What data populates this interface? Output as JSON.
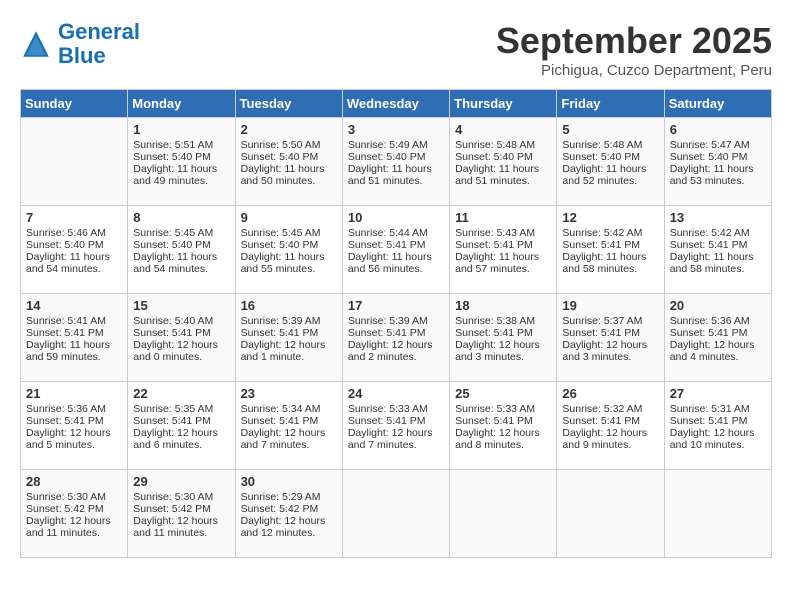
{
  "header": {
    "logo_general": "General",
    "logo_blue": "Blue",
    "month": "September 2025",
    "location": "Pichigua, Cuzco Department, Peru"
  },
  "days_of_week": [
    "Sunday",
    "Monday",
    "Tuesday",
    "Wednesday",
    "Thursday",
    "Friday",
    "Saturday"
  ],
  "weeks": [
    [
      {
        "day": "",
        "sunrise": "",
        "sunset": "",
        "daylight": ""
      },
      {
        "day": "1",
        "sunrise": "Sunrise: 5:51 AM",
        "sunset": "Sunset: 5:40 PM",
        "daylight": "Daylight: 11 hours and 49 minutes."
      },
      {
        "day": "2",
        "sunrise": "Sunrise: 5:50 AM",
        "sunset": "Sunset: 5:40 PM",
        "daylight": "Daylight: 11 hours and 50 minutes."
      },
      {
        "day": "3",
        "sunrise": "Sunrise: 5:49 AM",
        "sunset": "Sunset: 5:40 PM",
        "daylight": "Daylight: 11 hours and 51 minutes."
      },
      {
        "day": "4",
        "sunrise": "Sunrise: 5:48 AM",
        "sunset": "Sunset: 5:40 PM",
        "daylight": "Daylight: 11 hours and 51 minutes."
      },
      {
        "day": "5",
        "sunrise": "Sunrise: 5:48 AM",
        "sunset": "Sunset: 5:40 PM",
        "daylight": "Daylight: 11 hours and 52 minutes."
      },
      {
        "day": "6",
        "sunrise": "Sunrise: 5:47 AM",
        "sunset": "Sunset: 5:40 PM",
        "daylight": "Daylight: 11 hours and 53 minutes."
      }
    ],
    [
      {
        "day": "7",
        "sunrise": "Sunrise: 5:46 AM",
        "sunset": "Sunset: 5:40 PM",
        "daylight": "Daylight: 11 hours and 54 minutes."
      },
      {
        "day": "8",
        "sunrise": "Sunrise: 5:45 AM",
        "sunset": "Sunset: 5:40 PM",
        "daylight": "Daylight: 11 hours and 54 minutes."
      },
      {
        "day": "9",
        "sunrise": "Sunrise: 5:45 AM",
        "sunset": "Sunset: 5:40 PM",
        "daylight": "Daylight: 11 hours and 55 minutes."
      },
      {
        "day": "10",
        "sunrise": "Sunrise: 5:44 AM",
        "sunset": "Sunset: 5:41 PM",
        "daylight": "Daylight: 11 hours and 56 minutes."
      },
      {
        "day": "11",
        "sunrise": "Sunrise: 5:43 AM",
        "sunset": "Sunset: 5:41 PM",
        "daylight": "Daylight: 11 hours and 57 minutes."
      },
      {
        "day": "12",
        "sunrise": "Sunrise: 5:42 AM",
        "sunset": "Sunset: 5:41 PM",
        "daylight": "Daylight: 11 hours and 58 minutes."
      },
      {
        "day": "13",
        "sunrise": "Sunrise: 5:42 AM",
        "sunset": "Sunset: 5:41 PM",
        "daylight": "Daylight: 11 hours and 58 minutes."
      }
    ],
    [
      {
        "day": "14",
        "sunrise": "Sunrise: 5:41 AM",
        "sunset": "Sunset: 5:41 PM",
        "daylight": "Daylight: 11 hours and 59 minutes."
      },
      {
        "day": "15",
        "sunrise": "Sunrise: 5:40 AM",
        "sunset": "Sunset: 5:41 PM",
        "daylight": "Daylight: 12 hours and 0 minutes."
      },
      {
        "day": "16",
        "sunrise": "Sunrise: 5:39 AM",
        "sunset": "Sunset: 5:41 PM",
        "daylight": "Daylight: 12 hours and 1 minute."
      },
      {
        "day": "17",
        "sunrise": "Sunrise: 5:39 AM",
        "sunset": "Sunset: 5:41 PM",
        "daylight": "Daylight: 12 hours and 2 minutes."
      },
      {
        "day": "18",
        "sunrise": "Sunrise: 5:38 AM",
        "sunset": "Sunset: 5:41 PM",
        "daylight": "Daylight: 12 hours and 3 minutes."
      },
      {
        "day": "19",
        "sunrise": "Sunrise: 5:37 AM",
        "sunset": "Sunset: 5:41 PM",
        "daylight": "Daylight: 12 hours and 3 minutes."
      },
      {
        "day": "20",
        "sunrise": "Sunrise: 5:36 AM",
        "sunset": "Sunset: 5:41 PM",
        "daylight": "Daylight: 12 hours and 4 minutes."
      }
    ],
    [
      {
        "day": "21",
        "sunrise": "Sunrise: 5:36 AM",
        "sunset": "Sunset: 5:41 PM",
        "daylight": "Daylight: 12 hours and 5 minutes."
      },
      {
        "day": "22",
        "sunrise": "Sunrise: 5:35 AM",
        "sunset": "Sunset: 5:41 PM",
        "daylight": "Daylight: 12 hours and 6 minutes."
      },
      {
        "day": "23",
        "sunrise": "Sunrise: 5:34 AM",
        "sunset": "Sunset: 5:41 PM",
        "daylight": "Daylight: 12 hours and 7 minutes."
      },
      {
        "day": "24",
        "sunrise": "Sunrise: 5:33 AM",
        "sunset": "Sunset: 5:41 PM",
        "daylight": "Daylight: 12 hours and 7 minutes."
      },
      {
        "day": "25",
        "sunrise": "Sunrise: 5:33 AM",
        "sunset": "Sunset: 5:41 PM",
        "daylight": "Daylight: 12 hours and 8 minutes."
      },
      {
        "day": "26",
        "sunrise": "Sunrise: 5:32 AM",
        "sunset": "Sunset: 5:41 PM",
        "daylight": "Daylight: 12 hours and 9 minutes."
      },
      {
        "day": "27",
        "sunrise": "Sunrise: 5:31 AM",
        "sunset": "Sunset: 5:41 PM",
        "daylight": "Daylight: 12 hours and 10 minutes."
      }
    ],
    [
      {
        "day": "28",
        "sunrise": "Sunrise: 5:30 AM",
        "sunset": "Sunset: 5:42 PM",
        "daylight": "Daylight: 12 hours and 11 minutes."
      },
      {
        "day": "29",
        "sunrise": "Sunrise: 5:30 AM",
        "sunset": "Sunset: 5:42 PM",
        "daylight": "Daylight: 12 hours and 11 minutes."
      },
      {
        "day": "30",
        "sunrise": "Sunrise: 5:29 AM",
        "sunset": "Sunset: 5:42 PM",
        "daylight": "Daylight: 12 hours and 12 minutes."
      },
      {
        "day": "",
        "sunrise": "",
        "sunset": "",
        "daylight": ""
      },
      {
        "day": "",
        "sunrise": "",
        "sunset": "",
        "daylight": ""
      },
      {
        "day": "",
        "sunrise": "",
        "sunset": "",
        "daylight": ""
      },
      {
        "day": "",
        "sunrise": "",
        "sunset": "",
        "daylight": ""
      }
    ]
  ]
}
